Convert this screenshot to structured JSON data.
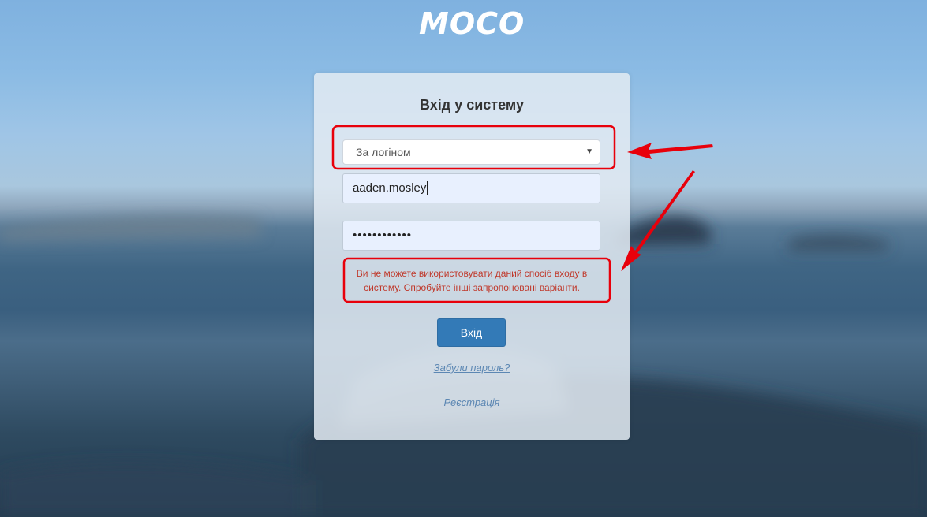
{
  "app": {
    "logo_text": "MOCO"
  },
  "login_form": {
    "title": "Вхід у систему",
    "method_select": {
      "selected": "За логіном"
    },
    "login_field": {
      "value": "aaden.mosley"
    },
    "password_field": {
      "value": "••••••••••••"
    },
    "error_message": "Ви не можете використовувати даний спосіб входу в систему. Спробуйте інші запропоновані варіанти.",
    "submit_label": "Вхід",
    "forgot_password_link": "Забули пароль?",
    "register_link": "Реєстрація"
  },
  "colors": {
    "primary_button": "#337ab7",
    "error_text": "#c0392b",
    "annotation_red": "#e8000b",
    "link": "#5c87b3"
  }
}
